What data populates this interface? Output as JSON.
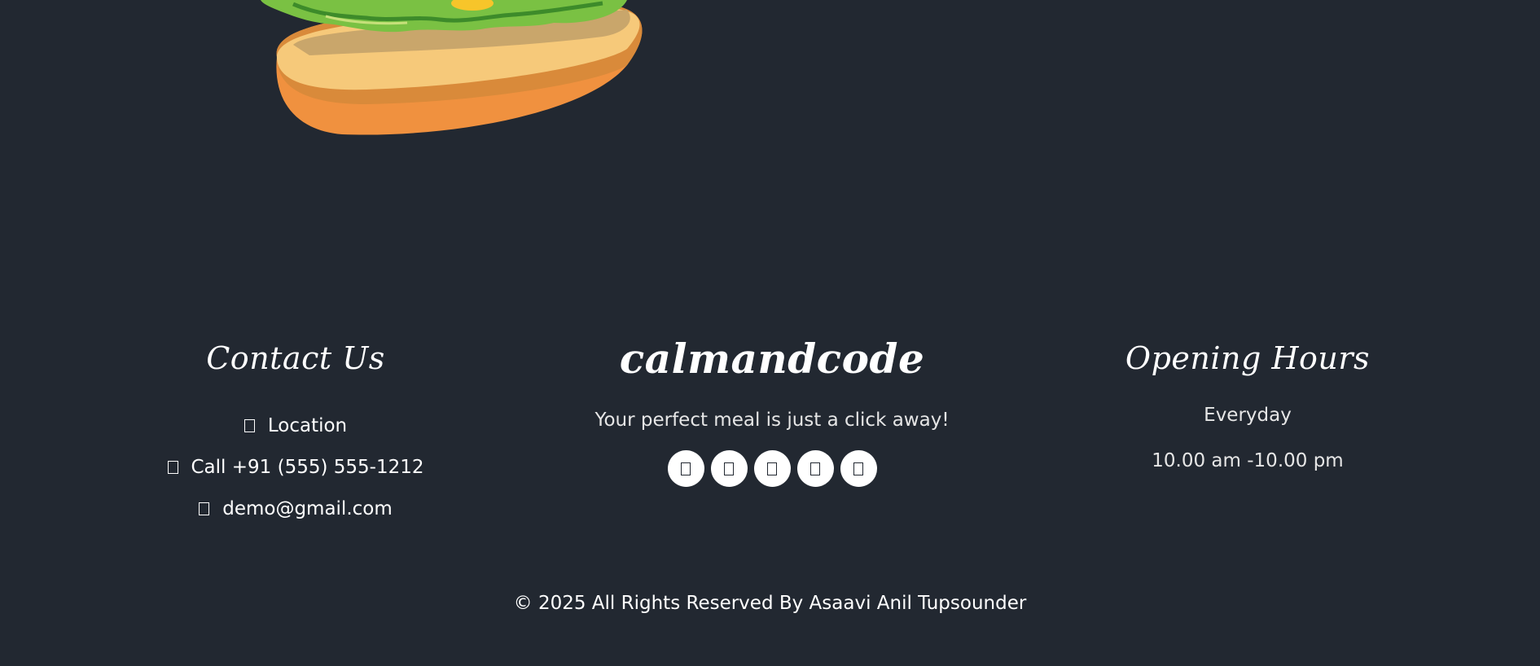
{
  "contact": {
    "title": "Contact Us",
    "items": [
      {
        "icon": "map-marker-icon",
        "label": "Location"
      },
      {
        "icon": "phone-icon",
        "label": "Call +91 (555) 555-1212"
      },
      {
        "icon": "envelope-icon",
        "label": "demo@gmail.com"
      }
    ]
  },
  "brand": {
    "name": "calmandcode",
    "tagline": "Your perfect meal is just a click away!",
    "social": [
      {
        "icon": "facebook-icon"
      },
      {
        "icon": "twitter-icon"
      },
      {
        "icon": "linkedin-icon"
      },
      {
        "icon": "instagram-icon"
      },
      {
        "icon": "pinterest-icon"
      }
    ]
  },
  "hours": {
    "title": "Opening Hours",
    "day": "Everyday",
    "time": "10.00 am -10.00 pm"
  },
  "copyright": "© 2025 All Rights Reserved By Asaavi Anil Tupsounder",
  "colors": {
    "background": "#222831",
    "text": "#ffffff",
    "muted_text": "#e6e6e6"
  }
}
